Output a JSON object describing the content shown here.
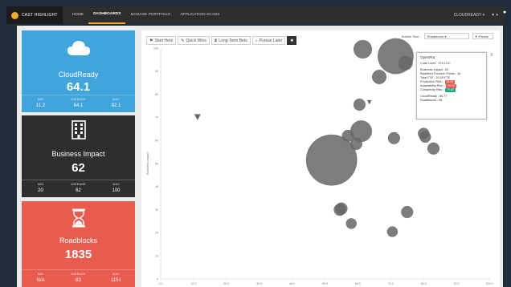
{
  "app": {
    "logo_text": "CAST HIGHLIGHT",
    "nav": [
      "HOME",
      "DASHBOARDS",
      "MANAGE PORTFOLIO",
      "APPLICATION SCANS"
    ],
    "active_nav": "DASHBOARDS",
    "account": "CLOUDREADY ▾",
    "settings": "▼ ▾"
  },
  "cards": [
    {
      "title": "CloudReady",
      "value": "64.1",
      "color": "#41a4dd",
      "icon": "cloud-icon",
      "stats": [
        {
          "label": "MIN",
          "value": "11.2"
        },
        {
          "label": "AVERAGE",
          "value": "64.1"
        },
        {
          "label": "MAX",
          "value": "82.1"
        }
      ]
    },
    {
      "title": "Business Impact",
      "value": "62",
      "color": "#2e2e2e",
      "icon": "building-icon",
      "stats": [
        {
          "label": "MIN",
          "value": "20"
        },
        {
          "label": "AVERAGE",
          "value": "62"
        },
        {
          "label": "MAX",
          "value": "100"
        }
      ]
    },
    {
      "title": "Roadblocks",
      "value": "1835",
      "color": "#e85b4e",
      "icon": "hourglass-icon",
      "stats": [
        {
          "label": "MIN",
          "value": "N/A"
        },
        {
          "label": "AVERAGE",
          "value": "83"
        },
        {
          "label": "MAX",
          "value": "1151"
        }
      ]
    }
  ],
  "filters": [
    {
      "label": "Start Here",
      "icon": "flag-icon"
    },
    {
      "label": "Quick Wins",
      "icon": "pencil-icon"
    },
    {
      "label": "Long-Term Bets",
      "icon": "hourglass-icon"
    },
    {
      "label": "Pursue Later",
      "icon": "home-icon"
    }
  ],
  "bubble_size": {
    "label": "Bubble Size :",
    "selected": "Roadblocks ▾",
    "filter": "▼ Panels"
  },
  "tooltip": {
    "title": "OpenRia",
    "code_lines": "Code Lines : 976 LOC",
    "business_impact": "Business Impact : 63",
    "bfp": "Backfired Function Points : 1k",
    "total_fte": "Total FTE : 20.00 FTE",
    "production_risk_label": "Production Risk :",
    "production_risk": "66.63",
    "adaptability_risk_label": "Adaptability Risk :",
    "adaptability_risk": "66.26",
    "complexity_risk_label": "Complexity Risk :",
    "complexity_risk": "77.67",
    "cloudready": "CloudReady : 66.77",
    "roadblocks": "Roadblocks : 58"
  },
  "chart_data": {
    "type": "scatter",
    "ylabel": "Business Impact",
    "xlim": [
      0,
      100
    ],
    "ylim": [
      0,
      100
    ],
    "x_ticks": [
      "0.0",
      "10.0",
      "20.0",
      "30.0",
      "40.0",
      "50.0",
      "60.0",
      "70.0",
      "80.0",
      "90.0",
      "100.0"
    ],
    "y_ticks": [
      "0",
      "10",
      "20",
      "30",
      "40",
      "50",
      "60",
      "70",
      "80",
      "90",
      "100"
    ],
    "points": [
      {
        "x": 11.2,
        "y": 70,
        "size": 0,
        "marker": "triangle"
      },
      {
        "x": 61.5,
        "y": 99.5,
        "size": 2
      },
      {
        "x": 71.5,
        "y": 96.5,
        "size": 10
      },
      {
        "x": 74.5,
        "y": 93.5,
        "size": 1
      },
      {
        "x": 66.5,
        "y": 87.5,
        "size": 1
      },
      {
        "x": 60.5,
        "y": 75.5,
        "size": 0.6
      },
      {
        "x": 63.5,
        "y": 76.5,
        "size": 0,
        "marker": "triangle"
      },
      {
        "x": 61.0,
        "y": 64,
        "size": 3
      },
      {
        "x": 57.0,
        "y": 62,
        "size": 0.6
      },
      {
        "x": 71.0,
        "y": 61,
        "size": 0.6
      },
      {
        "x": 59.5,
        "y": 58.5,
        "size": 0.6
      },
      {
        "x": 80.0,
        "y": 63,
        "size": 0.5
      },
      {
        "x": 80.5,
        "y": 61.5,
        "size": 0.5
      },
      {
        "x": 83.0,
        "y": 56.5,
        "size": 0.6
      },
      {
        "x": 52.0,
        "y": 51.5,
        "size": 22
      },
      {
        "x": 55.0,
        "y": 30.5,
        "size": 0.6
      },
      {
        "x": 54.5,
        "y": 30,
        "size": 0.6
      },
      {
        "x": 75.0,
        "y": 29,
        "size": 0.6
      },
      {
        "x": 58.0,
        "y": 24,
        "size": 0.4
      },
      {
        "x": 70.5,
        "y": 20.5,
        "size": 0.4
      }
    ]
  }
}
